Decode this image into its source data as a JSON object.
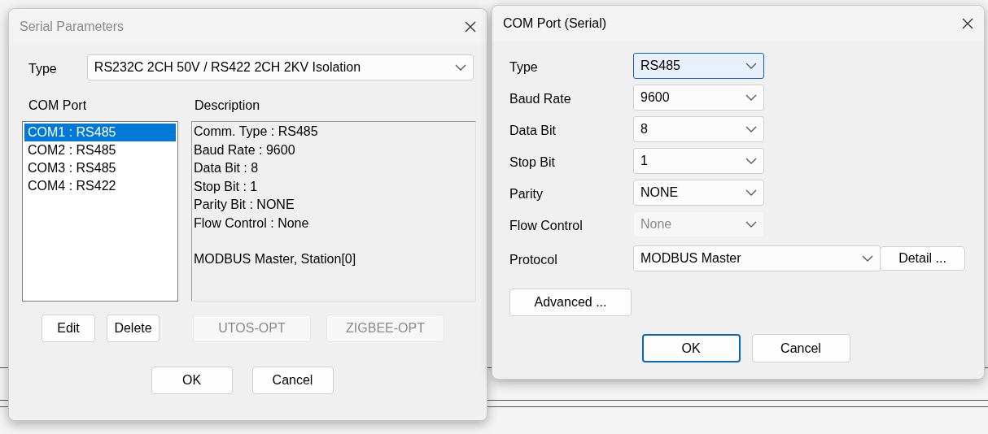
{
  "serial_parameters": {
    "title": "Serial Parameters",
    "active": false,
    "type_label": "Type",
    "type_value": "RS232C 2CH 50V / RS422 2CH 2KV Isolation",
    "com_port_label": "COM Port",
    "description_label": "Description",
    "ports": [
      {
        "label": "COM1 : RS485",
        "selected": true
      },
      {
        "label": "COM2 : RS485",
        "selected": false
      },
      {
        "label": "COM3 : RS485",
        "selected": false
      },
      {
        "label": "COM4 : RS422",
        "selected": false
      }
    ],
    "description_paragraphs": [
      [
        "Comm. Type : RS485",
        "Baud Rate : 9600",
        "Data Bit : 8",
        "Stop Bit : 1",
        "Parity Bit : NONE",
        "Flow Control : None"
      ],
      [
        "MODBUS Master, Station[0]"
      ]
    ],
    "port_buttons": [
      {
        "label": "Edit",
        "disabled": false
      },
      {
        "label": "Delete",
        "disabled": false
      }
    ],
    "option_buttons": [
      {
        "label": "UTOS-OPT",
        "disabled": true
      },
      {
        "label": "ZIGBEE-OPT",
        "disabled": true
      }
    ],
    "dialog_buttons": [
      {
        "label": "OK",
        "default": false
      },
      {
        "label": "Cancel",
        "default": false
      }
    ]
  },
  "com_port_dialog": {
    "title": "COM Port (Serial)",
    "active": true,
    "fields": [
      {
        "label": "Type",
        "value": "RS485",
        "focused": true,
        "disabled": false
      },
      {
        "label": "Baud Rate",
        "value": "9600",
        "focused": false,
        "disabled": false
      },
      {
        "label": "Data Bit",
        "value": "8",
        "focused": false,
        "disabled": false
      },
      {
        "label": "Stop Bit",
        "value": "1",
        "focused": false,
        "disabled": false
      },
      {
        "label": "Parity",
        "value": "NONE",
        "focused": false,
        "disabled": false
      },
      {
        "label": "Flow Control",
        "value": "None",
        "focused": false,
        "disabled": true
      },
      {
        "label": "Protocol",
        "value": "MODBUS Master",
        "focused": false,
        "disabled": false,
        "button": "Detail ..."
      }
    ],
    "advanced_button": "Advanced ...",
    "dialog_buttons": [
      {
        "label": "OK",
        "default": true
      },
      {
        "label": "Cancel",
        "default": false
      }
    ]
  }
}
